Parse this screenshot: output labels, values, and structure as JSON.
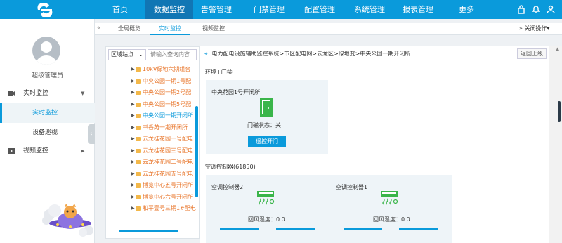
{
  "topbar": {
    "nav": [
      "首页",
      "数据监控",
      "告警管理",
      "门禁管理",
      "配置管理",
      "系统管理",
      "报表管理",
      "更多"
    ],
    "active_index": 1
  },
  "sidebar": {
    "user": "超级管理员",
    "items": [
      {
        "label": "实时监控",
        "icon": "monitor-icon",
        "expanded": true
      },
      {
        "label": "实时监控",
        "active": true
      },
      {
        "label": "设备巡视"
      },
      {
        "label": "视频监控",
        "icon": "video-icon"
      }
    ]
  },
  "tabs": {
    "items": [
      "全局概览",
      "实时监控",
      "视频监控"
    ],
    "active_index": 1,
    "close_ops": "关闭操作▾"
  },
  "tree": {
    "area_select": "区域站点",
    "search_placeholder": "请输入查询内容",
    "nodes": [
      "10kV绿地六期组合",
      "中央公园一期1号配",
      "中央公园一期2号配",
      "中央公园一期5号配",
      "中央公园一期开闭所",
      "书香苑一期开闭所",
      "云龙桂花园一号配电",
      "云龙桂花园三号配电",
      "云龙桂花园二号配电",
      "云龙桂花园五号配电",
      "博览中心五号开闭所",
      "博览中心六号开闭所",
      "和平壹号三期1#配电"
    ]
  },
  "main": {
    "path": "电力配电设施辅助监控系统>市区配电网>云龙区>绿地变>中央公园一期开闭所",
    "back": "返回上级",
    "section_env": "环境+门禁",
    "door_card": {
      "title": "中央花园1号开闭所",
      "status": "门磁状态：关",
      "button": "遥控开门"
    },
    "section_ac": "空调控制器(61850)",
    "ac": [
      {
        "name": "空调控制器2",
        "return_temp": "回风温度：0.0"
      },
      {
        "name": "空调控制器1",
        "return_temp": "回风温度：0.0"
      }
    ]
  },
  "colors": {
    "primary": "#0a9adb",
    "nav_active": "#1176b4",
    "tree_text": "#e8752a",
    "door_green": "#3ab54a"
  }
}
